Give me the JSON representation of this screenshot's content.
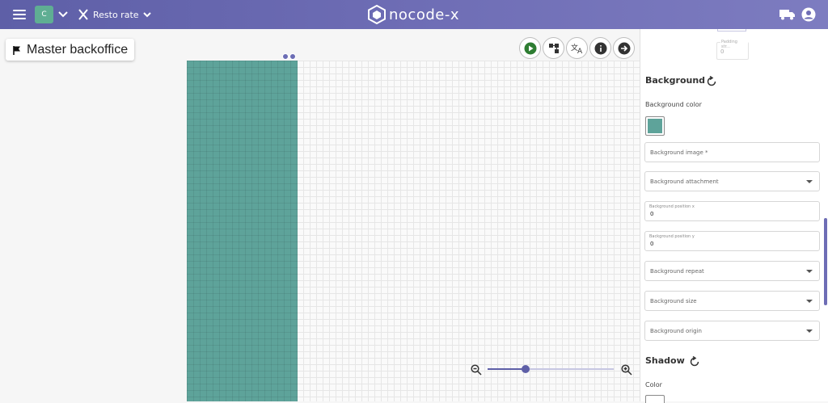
{
  "topbar": {
    "app_initial": "C",
    "project_name": "Resto rate",
    "logo_text": "nocode-x",
    "colors": {
      "gradient_start": "#5e5fa7",
      "gradient_end": "#7d7cc0",
      "app_tile": "#5fae93"
    }
  },
  "page": {
    "name": "Master backoffice"
  },
  "canvas": {
    "block_color": "#5ea39a"
  },
  "zoom": {
    "level": 0.3
  },
  "panel": {
    "padding_bottom": {
      "label": "Padding str...",
      "value": "0"
    },
    "background": {
      "title": "Background",
      "color_label": "Background color",
      "color_value": "#5ea39a",
      "image_placeholder": "Background image *",
      "attachment_placeholder": "Background attachment",
      "position_x": {
        "label": "Background position x",
        "value": "0"
      },
      "position_y": {
        "label": "Background position y",
        "value": "0"
      },
      "repeat_placeholder": "Background repeat",
      "size_placeholder": "Background size",
      "origin_placeholder": "Background origin"
    },
    "shadow": {
      "title": "Shadow",
      "color_label": "Color"
    }
  }
}
